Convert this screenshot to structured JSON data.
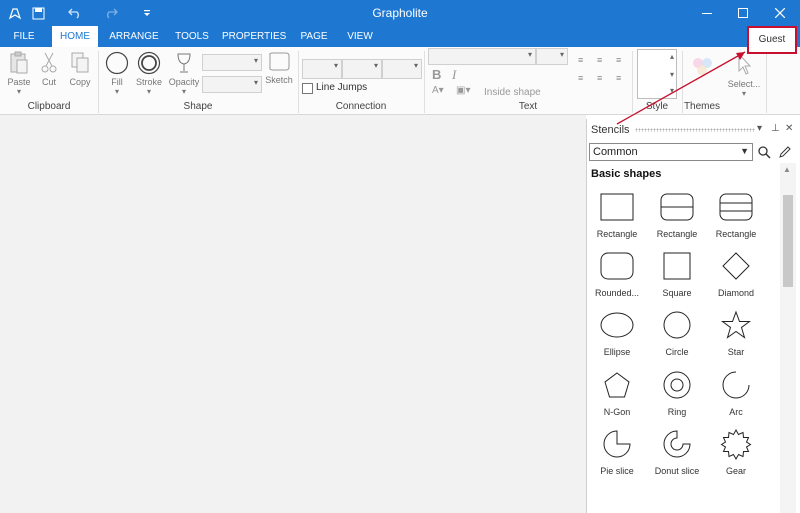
{
  "window": {
    "title": "Grapholite"
  },
  "menu_tabs": [
    {
      "label": "FILE"
    },
    {
      "label": "HOME"
    },
    {
      "label": "ARRANGE"
    },
    {
      "label": "TOOLS"
    },
    {
      "label": "PROPERTIES"
    },
    {
      "label": "PAGE"
    },
    {
      "label": "VIEW"
    }
  ],
  "user": {
    "label": "Guest"
  },
  "ribbon": {
    "clipboard": {
      "paste": "Paste",
      "cut": "Cut",
      "copy": "Copy",
      "group": "Clipboard"
    },
    "shape": {
      "fill": "Fill",
      "stroke": "Stroke",
      "opacity": "Opacity",
      "sketch": "Sketch",
      "group": "Shape"
    },
    "connection": {
      "line_jumps": "Line Jumps",
      "group": "Connection"
    },
    "text": {
      "inside_shape": "Inside shape",
      "group": "Text"
    },
    "style": {
      "group": "Style"
    },
    "themes": {
      "group": "Themes"
    },
    "select": {
      "label": "Select..."
    }
  },
  "stencils": {
    "title": "Stencils",
    "selected": "Common",
    "section": "Basic shapes",
    "shapes": [
      {
        "label": "Rectangle",
        "icon": "rect"
      },
      {
        "label": "Rectangle",
        "icon": "rect-one-line"
      },
      {
        "label": "Rectangle",
        "icon": "rect-two-lines"
      },
      {
        "label": "Rounded...",
        "icon": "rounded-rect"
      },
      {
        "label": "Square",
        "icon": "square"
      },
      {
        "label": "Diamond",
        "icon": "diamond"
      },
      {
        "label": "Ellipse",
        "icon": "ellipse"
      },
      {
        "label": "Circle",
        "icon": "circle"
      },
      {
        "label": "Star",
        "icon": "star"
      },
      {
        "label": "N-Gon",
        "icon": "pentagon"
      },
      {
        "label": "Ring",
        "icon": "ring"
      },
      {
        "label": "Arc",
        "icon": "arc"
      },
      {
        "label": "Pie slice",
        "icon": "pie-slice"
      },
      {
        "label": "Donut slice",
        "icon": "donut-slice"
      },
      {
        "label": "Gear",
        "icon": "gear"
      }
    ]
  },
  "colors": {
    "accent": "#1e78d2",
    "annotation": "#c8102e"
  }
}
